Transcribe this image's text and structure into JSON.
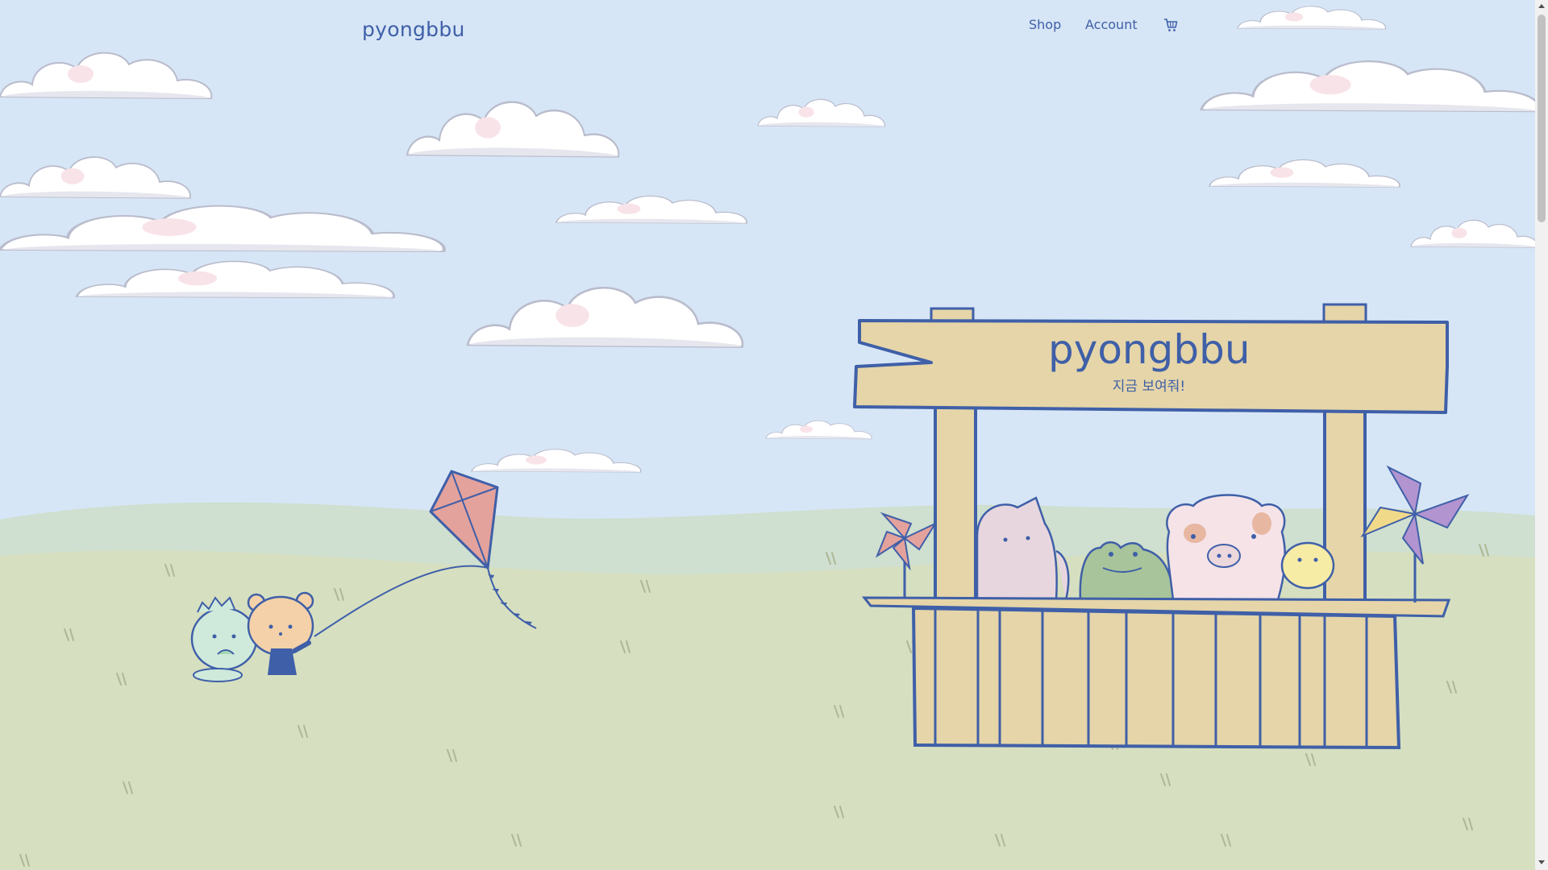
{
  "app": {
    "logo": "pyongbbu"
  },
  "nav": {
    "items": [
      {
        "label": "Shop"
      },
      {
        "label": "Account"
      }
    ],
    "cart_icon": "cart-icon"
  },
  "hero": {
    "sign_title": "pyongbbu",
    "sign_subtitle": "지금 보여줘!"
  },
  "colors": {
    "sky": "#d7e6f6",
    "grass": "#d6dfc0",
    "accent": "#3f5fa8",
    "wood": "#e5d5a8"
  }
}
